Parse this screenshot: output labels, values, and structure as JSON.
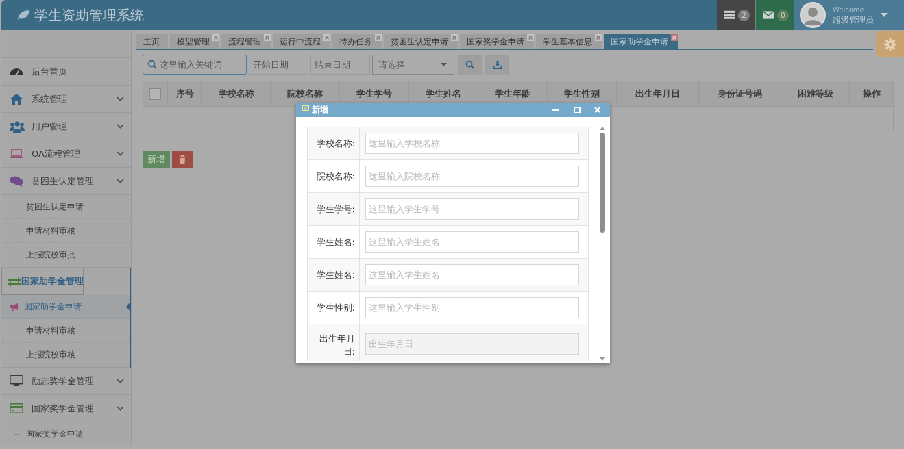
{
  "header": {
    "title": "学生资助管理系统",
    "notifications": [
      {
        "kind": "tasks",
        "count": "2"
      },
      {
        "kind": "messages",
        "count": "0"
      }
    ],
    "user": {
      "greeting": "Welcome",
      "name": "超级管理员"
    }
  },
  "sidebar": {
    "items": [
      {
        "label": "后台首页",
        "selected": false
      },
      {
        "label": "系统管理",
        "selected": false
      },
      {
        "label": "用户管理",
        "selected": false
      },
      {
        "label": "OA流程管理",
        "selected": false
      },
      {
        "label": "贫困生认定管理",
        "selected": false,
        "children": [
          {
            "label": "贫困生认定申请",
            "selected": false
          },
          {
            "label": "申请材料审核",
            "selected": false
          },
          {
            "label": "上报院校审批",
            "selected": false
          }
        ]
      },
      {
        "label": "国家助学金管理",
        "selected": true,
        "children": [
          {
            "label": "国家助学金申请",
            "selected": true
          },
          {
            "label": "申请材料审核",
            "selected": false
          },
          {
            "label": "上报院校审核",
            "selected": false
          }
        ]
      },
      {
        "label": "励志奖学金管理",
        "selected": false
      },
      {
        "label": "国家奖学金管理",
        "selected": false,
        "children": [
          {
            "label": "国家奖学金申请",
            "selected": false
          }
        ]
      }
    ]
  },
  "tabs": [
    {
      "label": "主页",
      "closable": false,
      "selected": false
    },
    {
      "label": "模型管理",
      "closable": true,
      "selected": false
    },
    {
      "label": "流程管理",
      "closable": true,
      "selected": false
    },
    {
      "label": "运行中流程",
      "closable": true,
      "selected": false
    },
    {
      "label": "待办任务",
      "closable": true,
      "selected": false
    },
    {
      "label": "贫困生认定申请",
      "closable": true,
      "selected": false
    },
    {
      "label": "国家奖学金申请",
      "closable": true,
      "selected": false
    },
    {
      "label": "学生基本信息",
      "closable": true,
      "selected": false
    },
    {
      "label": "国家助学金申请",
      "closable": true,
      "selected": true
    }
  ],
  "toolbar": {
    "keyword": {
      "placeholder": "这里输入关键词"
    },
    "start_date": {
      "placeholder": "开始日期"
    },
    "end_date": {
      "placeholder": "结束日期"
    },
    "select": {
      "value": "请选择"
    }
  },
  "table": {
    "header_checkbox": {
      "checked": false
    },
    "columns": [
      "序号",
      "学校名称",
      "院校名称",
      "学生学号",
      "学生姓名",
      "学生年龄",
      "学生性别",
      "出生年月日",
      "身份证号码",
      "困难等级",
      "操作"
    ]
  },
  "actions": {
    "add": "新增"
  },
  "dialog": {
    "title": "新增",
    "fields": [
      {
        "label": "学校名称:",
        "placeholder": "这里输入学校名称",
        "disabled": false
      },
      {
        "label": "院校名称:",
        "placeholder": "这里输入院校名称",
        "disabled": false
      },
      {
        "label": "学生学号:",
        "placeholder": "这里输入学生学号",
        "disabled": false
      },
      {
        "label": "学生姓名:",
        "placeholder": "这里输入学生姓名",
        "disabled": false
      },
      {
        "label": "学生姓名:",
        "placeholder": "这里输入学生姓名",
        "disabled": false
      },
      {
        "label": "学生性别:",
        "placeholder": "这里输入学生性别",
        "disabled": false
      },
      {
        "label": "出生年月日:",
        "placeholder": "出生年月日",
        "disabled": true
      }
    ]
  }
}
